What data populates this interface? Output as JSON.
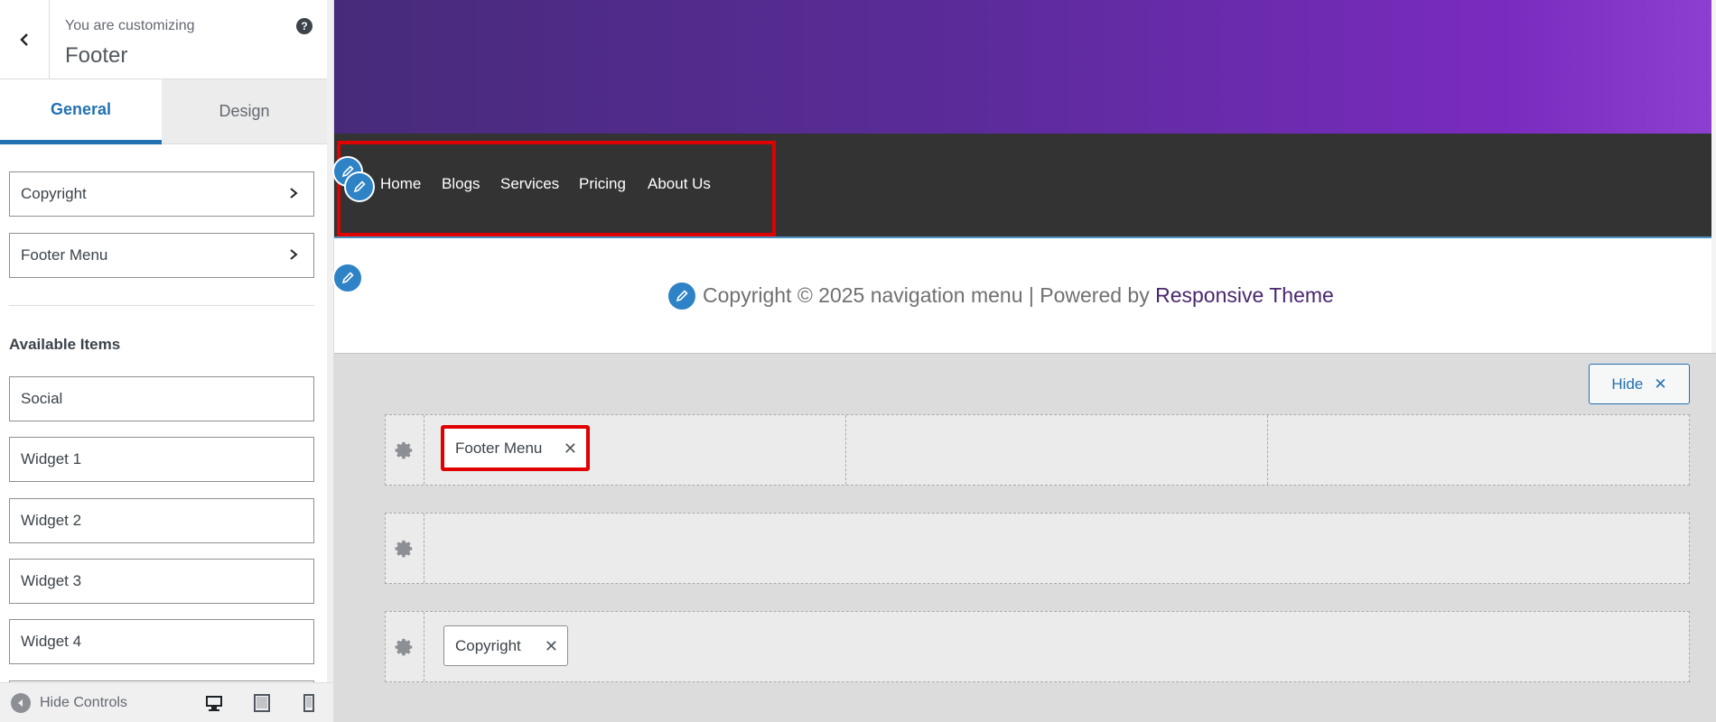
{
  "sidebar": {
    "header": {
      "customizing_label": "You are customizing",
      "section_title": "Footer",
      "help_icon": "?"
    },
    "tabs": [
      {
        "label": "General",
        "active": true
      },
      {
        "label": "Design",
        "active": false
      }
    ],
    "sections": [
      {
        "label": "Copyright"
      },
      {
        "label": "Footer Menu"
      }
    ],
    "available_title": "Available Items",
    "available_items": [
      {
        "label": "Social"
      },
      {
        "label": "Widget 1"
      },
      {
        "label": "Widget 2"
      },
      {
        "label": "Widget 3"
      },
      {
        "label": "Widget 4"
      }
    ],
    "footer": {
      "hide_controls_label": "Hide Controls",
      "devices": [
        "desktop-icon",
        "tablet-icon",
        "mobile-icon"
      ]
    }
  },
  "preview": {
    "nav_links": [
      "Home",
      "Blogs",
      "Services",
      "Pricing",
      "About Us"
    ],
    "copyright_text": "Copyright © 2025 navigation menu | Powered by ",
    "copyright_link": "Responsive Theme"
  },
  "builder": {
    "hide_label": "Hide",
    "rows": [
      {
        "items": [
          "Footer Menu"
        ]
      },
      {
        "items": []
      },
      {
        "items": [
          "Copyright"
        ]
      }
    ]
  },
  "colors": {
    "accent": "#2271b1",
    "highlight": "#e00000",
    "nav_bg": "#333333",
    "edit_pin": "#2e82c6",
    "link": "#49266e"
  }
}
